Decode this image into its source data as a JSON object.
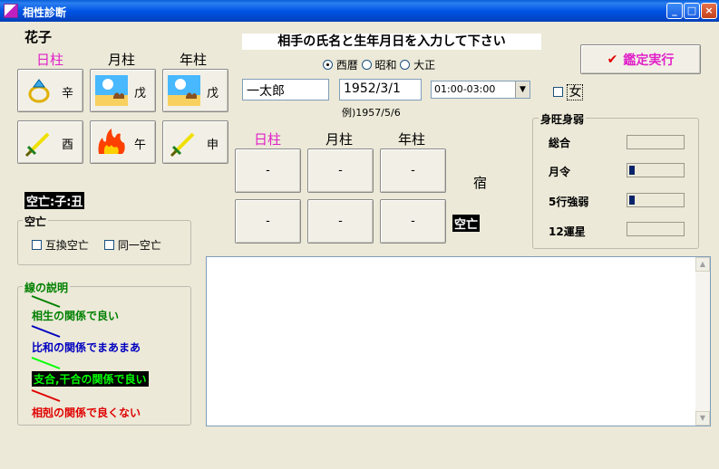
{
  "window": {
    "title": "相性診断"
  },
  "left": {
    "name": "花子",
    "pillar_headers": [
      "日柱",
      "月柱",
      "年柱"
    ],
    "stems": [
      "辛",
      "戊",
      "戊"
    ],
    "branches": [
      "酉",
      "午",
      "申"
    ],
    "icons_top": [
      "ring-icon",
      "camel-sun-icon",
      "camel-sun-icon"
    ],
    "icons_bottom": [
      "sword-icon",
      "fire-icon",
      "sword-icon"
    ],
    "kuubou_label": "空亡:子:丑"
  },
  "kuubou_group": {
    "title": "空亡",
    "checkbox1": "互換空亡",
    "checkbox2": "同一空亡"
  },
  "legend_group": {
    "title": "線の説明",
    "items": [
      {
        "text": "相生の関係で良い",
        "color": "#008000"
      },
      {
        "text": "比和の関係でまあまあ",
        "color": "#0000c0"
      },
      {
        "text": "支合,干合の関係で良い",
        "color": "#00ff00"
      },
      {
        "text": "相剋の関係で良くない",
        "color": "#e00000"
      }
    ]
  },
  "header": {
    "prompt": "相手の氏名と生年月日を入力して下さい",
    "era_options": [
      "西暦",
      "昭和",
      "大正"
    ],
    "era_selected": "西暦",
    "run_button": "鑑定実行",
    "run_icon": "check-icon"
  },
  "inputs": {
    "name_value": "一太郎",
    "date_value": "1952/3/1",
    "time_value": "01:00-03:00",
    "example": "例)1957/5/6",
    "gender_label": "女"
  },
  "partner": {
    "pillar_headers": [
      "日柱",
      "月柱",
      "年柱"
    ],
    "top_row": [
      "-",
      "-",
      "-"
    ],
    "bottom_row": [
      "-",
      "-",
      "-"
    ],
    "shuku_label": "宿",
    "kuubou_label": "空亡"
  },
  "strength_group": {
    "title": "身旺身弱",
    "rows": [
      {
        "label": "総合",
        "level": 0
      },
      {
        "label": "月令",
        "level": 0.1
      },
      {
        "label": "5行強弱",
        "level": 0.1
      },
      {
        "label": "12運星",
        "level": 0
      }
    ]
  },
  "colors": {
    "title_bar": "#0055e5",
    "accent_pink": "#e020c8",
    "meter_fill": "#0a246a"
  }
}
